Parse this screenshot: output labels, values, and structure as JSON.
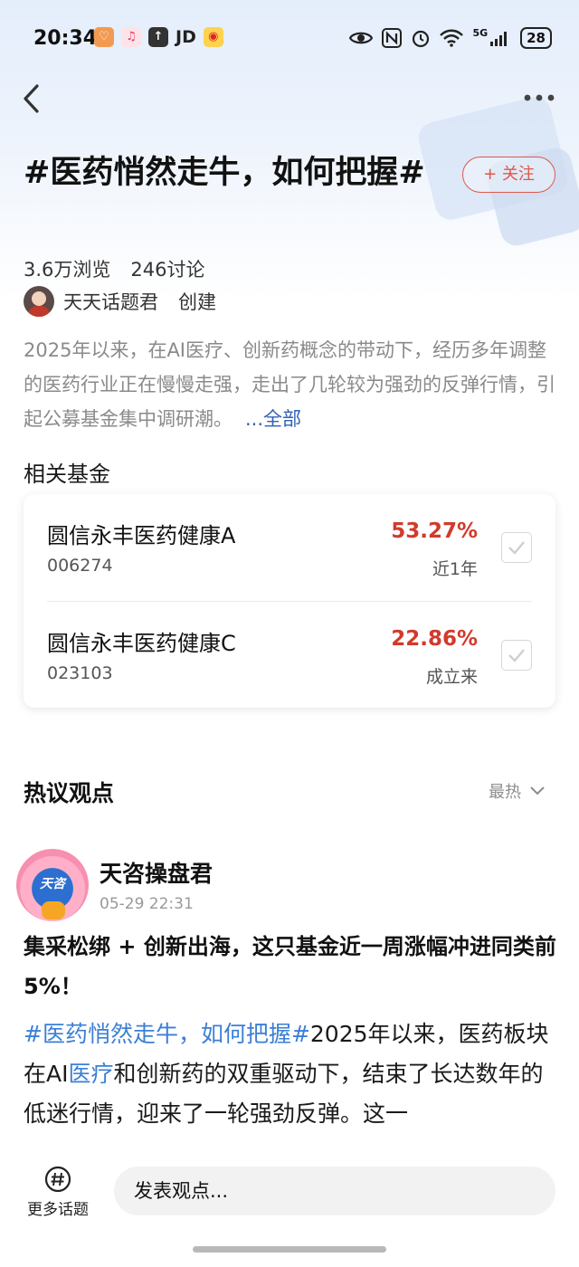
{
  "status_bar": {
    "time": "20:34",
    "jd_label": "JD",
    "network_label": "5G",
    "battery": "28"
  },
  "topic": {
    "title": "#医药悄然走牛，如何把握#",
    "follow_label": "+ 关注",
    "views": "3.6万浏览",
    "discussions": "246讨论",
    "creator_name": "天天话题君",
    "creator_role": "创建",
    "description": "2025年以来，在AI医疗、创新药概念的带动下，经历多年调整的医药行业正在慢慢走强，走出了几轮较为强劲的反弹行情，引起公募基金集中调研潮。",
    "more_label": "...全部"
  },
  "related_funds": {
    "label": "相关基金",
    "items": [
      {
        "name": "圆信永丰医药健康A",
        "code": "006274",
        "return": "53.27%",
        "period": "近1年"
      },
      {
        "name": "圆信永丰医药健康C",
        "code": "023103",
        "return": "22.86%",
        "period": "成立来"
      }
    ]
  },
  "hot_views": {
    "title": "热议观点",
    "sort_label": "最热"
  },
  "post": {
    "avatar_text": "天咨",
    "author": "天咨操盘君",
    "time": "05-29 22:31",
    "headline": "集采松绑 + 创新出海，这只基金近一周涨幅冲进同类前 5%！",
    "body_tag": "#医药悄然走牛，如何把握#",
    "body_part1": "2025年以来，医药板块在AI",
    "body_link": "医疗",
    "body_part2": "和创新药的双重驱动下，结束了长达数年的低迷行情，迎来了一轮强劲反弹。这一"
  },
  "bottom_bar": {
    "more_topics_label": "更多话题",
    "input_placeholder": "发表观点..."
  },
  "colors": {
    "accent_red": "#d23a2c",
    "follow_red": "#e0564a",
    "link_blue": "#3b7fd6"
  }
}
